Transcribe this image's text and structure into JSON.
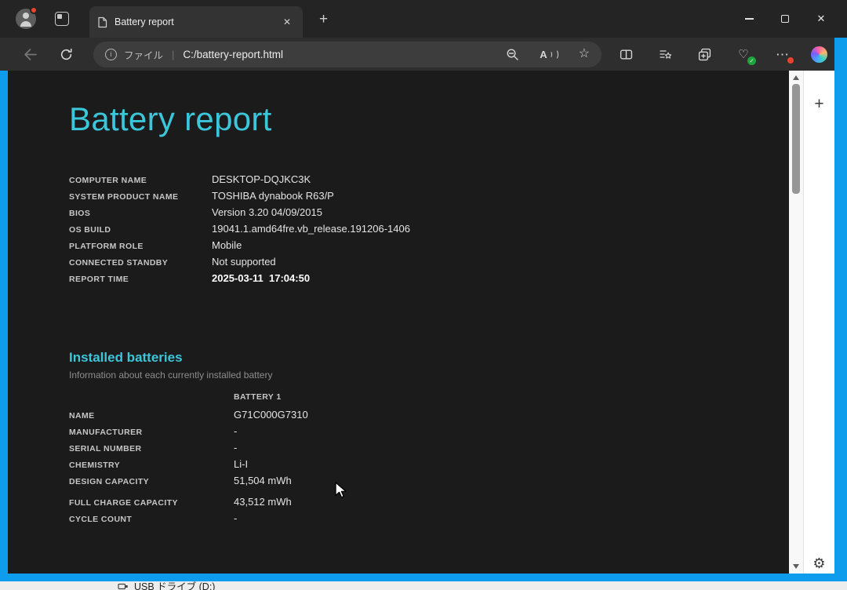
{
  "window": {
    "border_color": "#0e9cec",
    "controls": {
      "close_glyph": "✕"
    }
  },
  "tab_bar": {
    "tab_title": "Battery report",
    "tab_close_glyph": "✕",
    "new_tab_glyph": "+"
  },
  "toolbar": {
    "file_scheme_label": "ファイル",
    "separator_glyph": "|",
    "url": "C:/battery-report.html",
    "read_aloud_glyph": "A"
  },
  "icons": {
    "info_glyph": "i",
    "star_glyph": "☆",
    "more_glyph": "⋯",
    "heart_glyph": "♡",
    "check_glyph": "✓"
  },
  "sidebar": {
    "add_glyph": "+",
    "settings_glyph": "⚙"
  },
  "page": {
    "title": "Battery report",
    "system_info_rows": [
      {
        "label": "COMPUTER NAME",
        "value": "DESKTOP-DQJKC3K"
      },
      {
        "label": "SYSTEM PRODUCT NAME",
        "value": "TOSHIBA dynabook R63/P"
      },
      {
        "label": "BIOS",
        "value": "Version 3.20 04/09/2015"
      },
      {
        "label": "OS BUILD",
        "value": "19041.1.amd64fre.vb_release.191206-1406"
      },
      {
        "label": "PLATFORM ROLE",
        "value": "Mobile"
      },
      {
        "label": "CONNECTED STANDBY",
        "value": "Not supported"
      },
      {
        "label": "REPORT TIME",
        "value": "2025-03-11  17:04:50"
      }
    ],
    "installed": {
      "heading": "Installed batteries",
      "subtitle": "Information about each currently installed battery",
      "column_header": "BATTERY 1",
      "rows": [
        {
          "label": "NAME",
          "value": "G71C000G7310"
        },
        {
          "label": "MANUFACTURER",
          "value": "-"
        },
        {
          "label": "SERIAL NUMBER",
          "value": "-"
        },
        {
          "label": "CHEMISTRY",
          "value": "Li-I"
        },
        {
          "label": "DESIGN CAPACITY",
          "value": "51,504 mWh"
        },
        {
          "label": "FULL CHARGE CAPACITY",
          "value": "43,512 mWh"
        },
        {
          "label": "CYCLE COUNT",
          "value": "-"
        }
      ]
    }
  },
  "background_window": {
    "item_label": "USB ドライブ (D:)"
  }
}
